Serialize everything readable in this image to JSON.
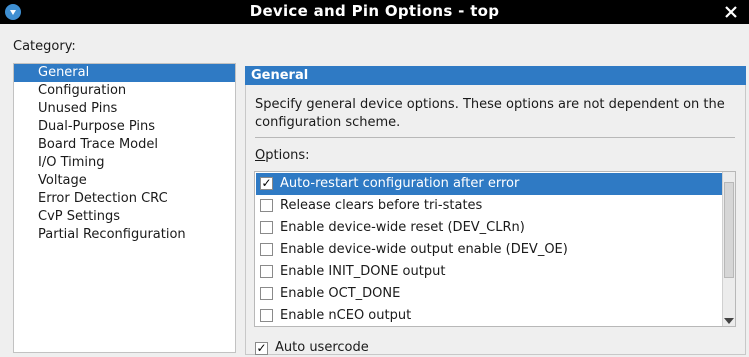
{
  "window": {
    "title": "Device and Pin Options - top",
    "close_icon": "close-icon",
    "app_icon": "quartus-app-icon"
  },
  "category": {
    "label": "Category:",
    "items": [
      {
        "label": "General",
        "selected": true
      },
      {
        "label": "Configuration",
        "selected": false
      },
      {
        "label": "Unused Pins",
        "selected": false
      },
      {
        "label": "Dual-Purpose Pins",
        "selected": false
      },
      {
        "label": "Board Trace Model",
        "selected": false
      },
      {
        "label": "I/O Timing",
        "selected": false
      },
      {
        "label": "Voltage",
        "selected": false
      },
      {
        "label": "Error Detection CRC",
        "selected": false
      },
      {
        "label": "CvP Settings",
        "selected": false
      },
      {
        "label": "Partial Reconfiguration",
        "selected": false
      }
    ]
  },
  "general": {
    "header": "General",
    "description": "Specify general device options. These options are not dependent on the configuration scheme.",
    "options_label": "Options:",
    "options": [
      {
        "label": "Auto-restart configuration after error",
        "checked": true,
        "selected": true
      },
      {
        "label": "Release clears before tri-states",
        "checked": false,
        "selected": false
      },
      {
        "label": "Enable device-wide reset (DEV_CLRn)",
        "checked": false,
        "selected": false
      },
      {
        "label": "Enable device-wide output enable (DEV_OE)",
        "checked": false,
        "selected": false
      },
      {
        "label": "Enable INIT_DONE output",
        "checked": false,
        "selected": false
      },
      {
        "label": "Enable OCT_DONE",
        "checked": false,
        "selected": false
      },
      {
        "label": "Enable nCEO output",
        "checked": false,
        "selected": false
      }
    ],
    "auto_usercode": {
      "label": "Auto usercode",
      "checked": true
    }
  },
  "colors": {
    "selection": "#2f7ac4",
    "titlebar": "#000000",
    "background": "#efefef"
  }
}
